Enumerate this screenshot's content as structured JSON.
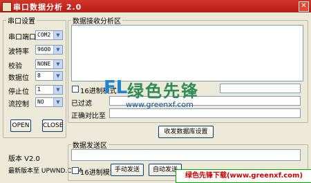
{
  "window": {
    "title": "串口数据分析 2.0",
    "close": "✕"
  },
  "serial": {
    "legend": "串口设置",
    "port_label": "串口端口",
    "port_value": "COM2",
    "baud_label": "波特率",
    "baud_value": "9600",
    "parity_label": "校验",
    "parity_value": "NONE",
    "data_label": "数据位",
    "data_value": "8",
    "stop_label": "停止位",
    "stop_value": "1",
    "flow_label": "流控制",
    "flow_value": "NO",
    "open": "OPEN",
    "close": "CLOSE"
  },
  "version": {
    "text": "版本 V2.0",
    "latest": "最新版本至 UPWND.COM"
  },
  "receive": {
    "legend": "数据接收分析区",
    "hex_mode": "16进制模式",
    "filtered_label": "已过滤",
    "regex_label": "正确对比至",
    "settings_button": "收发数据库设置"
  },
  "send": {
    "legend": "数据发送区",
    "hex_mode": "16进制模式",
    "manual": "手动发送",
    "auto": "自动发送"
  },
  "watermark": {
    "brand_mark": "FL",
    "brand_cn": "绿色先锋",
    "url": "www.greenxf.com",
    "banner": "绿色先锋下载(www.greenxf.com)"
  }
}
